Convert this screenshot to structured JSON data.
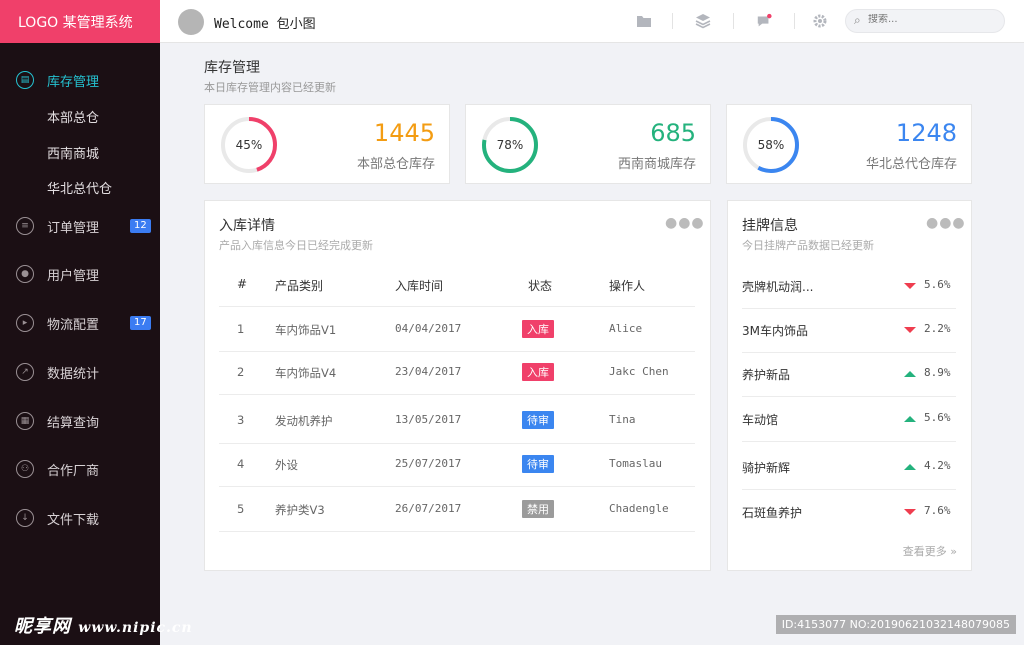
{
  "brand": {
    "logo": "LOGO  某管理系统",
    "accent": "#f0406a"
  },
  "sidebar": {
    "items": [
      {
        "label": "库存管理",
        "icon": "inventory-icon",
        "active": true
      },
      {
        "label": "订单管理",
        "icon": "order-icon",
        "badge": "12"
      },
      {
        "label": "用户管理",
        "icon": "user-icon"
      },
      {
        "label": "物流配置",
        "icon": "logistics-icon",
        "badge": "17"
      },
      {
        "label": "数据统计",
        "icon": "chart-icon"
      },
      {
        "label": "结算查询",
        "icon": "calculator-icon"
      },
      {
        "label": "合作厂商",
        "icon": "partner-icon"
      },
      {
        "label": "文件下载",
        "icon": "download-icon"
      }
    ],
    "subitems": [
      "本部总仓",
      "西南商城",
      "华北总代仓"
    ]
  },
  "header": {
    "welcome": "Welcome  包小图",
    "search_placeholder": "搜索...",
    "icons": [
      "folder-icon",
      "layers-icon",
      "message-icon",
      "settings-icon",
      "search-icon"
    ]
  },
  "page": {
    "title": "库存管理",
    "subtitle": "本日库存管理内容已经更新"
  },
  "stats": [
    {
      "percent_label": "45%",
      "percent": 45,
      "value": "1445",
      "label": "本部总仓库存",
      "color": "#f0406a",
      "num_color": "#f39c12"
    },
    {
      "percent_label": "78%",
      "percent": 78,
      "value": "685",
      "label": "西南商城库存",
      "color": "#24b27d",
      "num_color": "#24b27d"
    },
    {
      "percent_label": "58%",
      "percent": 58,
      "value": "1248",
      "label": "华北总代仓库存",
      "color": "#3b86f0",
      "num_color": "#3b86f0"
    }
  ],
  "detail": {
    "title": "入库详情",
    "subtitle": "产品入库信息今日已经完成更新",
    "columns": [
      "#",
      "产品类别",
      "入库时间",
      "状态",
      "操作人"
    ],
    "rows": [
      {
        "no": "1",
        "category": "车内饰品V1",
        "date": "04/04/2017",
        "status": "入库",
        "status_color": "#f0406a",
        "operator": "Alice"
      },
      {
        "no": "2",
        "category": "车内饰品V4",
        "date": "23/04/2017",
        "status": "入库",
        "status_color": "#f0406a",
        "operator": "Jakc Chen"
      },
      {
        "no": "3",
        "category": "发动机养护",
        "date": "13/05/2017",
        "status": "待审",
        "status_color": "#3b86f0",
        "operator": "Tina"
      },
      {
        "no": "4",
        "category": "外设",
        "date": "25/07/2017",
        "status": "待审",
        "status_color": "#3b86f0",
        "operator": "Tomaslau"
      },
      {
        "no": "5",
        "category": "养护类V3",
        "date": "26/07/2017",
        "status": "禁用",
        "status_color": "#9b9b9b",
        "operator": "Chadengle"
      }
    ]
  },
  "listing": {
    "title": "挂牌信息",
    "subtitle": "今日挂牌产品数据已经更新",
    "items": [
      {
        "name": "壳牌机动润...",
        "trend": "down",
        "value": "5.6%"
      },
      {
        "name": "3M车内饰品",
        "trend": "down",
        "value": "2.2%"
      },
      {
        "name": "养护新品",
        "trend": "up",
        "value": "8.9%"
      },
      {
        "name": "车动馆",
        "trend": "up",
        "value": "5.6%"
      },
      {
        "name": "骑护新辉",
        "trend": "up",
        "value": "4.2%"
      },
      {
        "name": "石斑鱼养护",
        "trend": "down",
        "value": "7.6%"
      }
    ],
    "see_more": "查看更多"
  },
  "watermark": {
    "site": "昵享网",
    "url": "www.nipic.cn",
    "id": "ID:4153077 NO:20190621032148079085"
  }
}
